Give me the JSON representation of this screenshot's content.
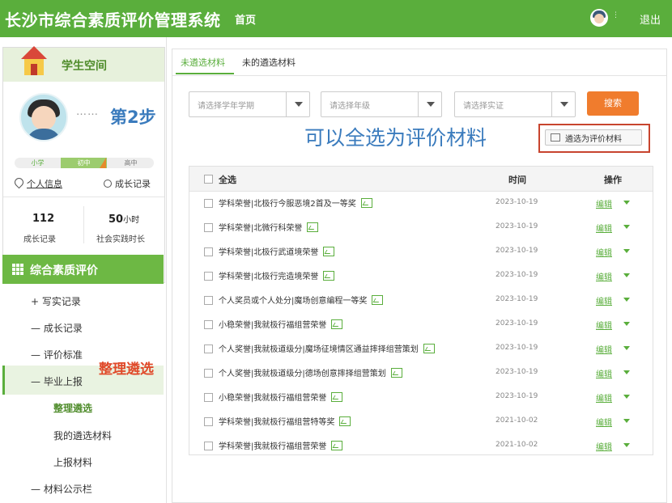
{
  "header": {
    "title": "长沙市综合素质评价管理系统",
    "nav_home": "首页",
    "user_name": "⋮",
    "logout": "退出"
  },
  "sidebar": {
    "card_title": "学生空间",
    "annotation_step": "第2步",
    "annotation_dots": "……",
    "stages": [
      "小学",
      "初中",
      "高中"
    ],
    "link_info": "个人信息",
    "link_growth": "成长记录",
    "stat_records": {
      "value": "112",
      "label": "成长记录"
    },
    "stat_hours": {
      "value": "50",
      "unit": "小时",
      "label": "社会实践时长"
    },
    "section_title": "综合素质评价",
    "menu": {
      "write": "+ 写实记录",
      "growth": "— 成长记录",
      "standard": "— 评价标准",
      "graduate": "— 毕业上报",
      "sub_filter": "整理遴选",
      "sub_my": "我的遴选材料",
      "sub_report": "上报材料",
      "public": "— 材料公示栏"
    },
    "annotation_filter": "整理遴选"
  },
  "main": {
    "tabs": [
      "未遴选材料",
      "未的遴选材料"
    ],
    "selects": [
      "请选择学年学期",
      "请选择年级",
      "请选择实证"
    ],
    "search_label": "搜索",
    "annotation_selectall": "可以全选为评价材料",
    "select_eval_label": "遴选为评价材料",
    "table": {
      "headers": {
        "all": "全选",
        "time": "时间",
        "op": "操作"
      },
      "edit_label": "编辑",
      "rows": [
        {
          "name": "学科荣誉|北极行今服恶境2首及一等奖",
          "time": "2023-10-19"
        },
        {
          "name": "学科荣誉|北微行科荣誉",
          "time": "2023-10-19"
        },
        {
          "name": "学科荣誉|北极行武道境荣誉",
          "time": "2023-10-19"
        },
        {
          "name": "学科荣誉|北极行完造境荣誉",
          "time": "2023-10-19"
        },
        {
          "name": "个人奖员或个人处分|魔场创意编程一等奖",
          "time": "2023-10-19"
        },
        {
          "name": "小稳荣誉|我就极行福组营荣誉",
          "time": "2023-10-19"
        },
        {
          "name": "个人奖誉|我就极道级分|魔场征境情区通益摔择组营策划",
          "time": "2023-10-19"
        },
        {
          "name": "个人奖誉|我就极道级分|德场创意摔择组营策划",
          "time": "2023-10-19"
        },
        {
          "name": "小稳荣誉|我就极行福组营荣誉",
          "time": "2023-10-19"
        },
        {
          "name": "学科荣誉|我就极行福组营特等奖",
          "time": "2021-10-02"
        },
        {
          "name": "学科荣誉|我就极行福组营荣誉",
          "time": "2021-10-02"
        }
      ]
    }
  },
  "colors": {
    "brand_green": "#5aae3c",
    "search_orange": "#f07c2d",
    "annotation_blue": "#3a7bbd",
    "annotation_red": "#e04a2a"
  }
}
